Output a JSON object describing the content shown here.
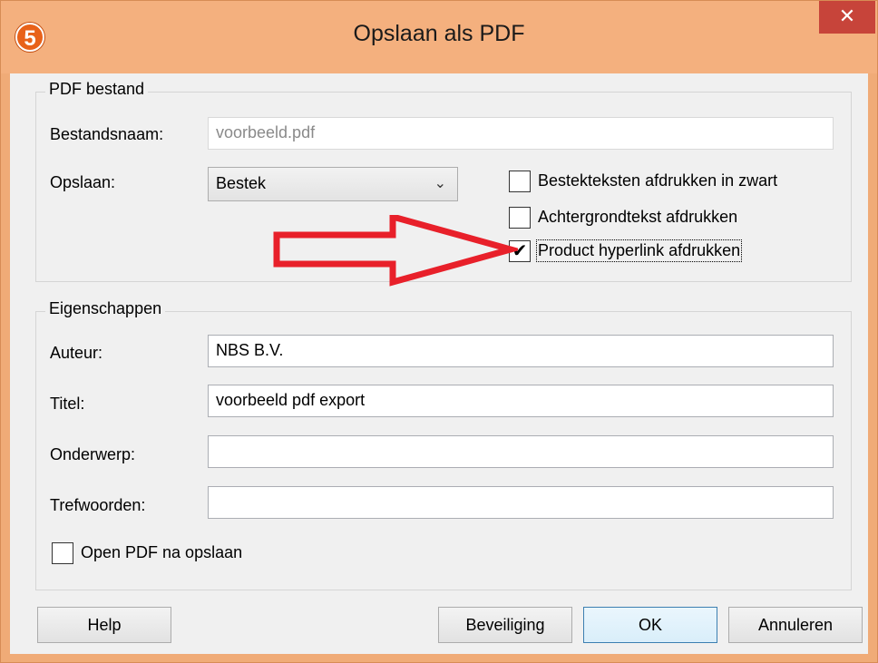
{
  "window": {
    "title": "Opslaan als PDF",
    "app_icon_glyph": "5",
    "close_glyph": "✕"
  },
  "pdf_group": {
    "legend": "PDF bestand",
    "filename_label": "Bestandsnaam:",
    "filename_value": "voorbeeld.pdf",
    "save_label": "Opslaan:",
    "save_selected": "Bestek",
    "checkboxes": [
      {
        "label": "Bestekteksten afdrukken in zwart",
        "checked": false
      },
      {
        "label": "Achtergrondtekst afdrukken",
        "checked": false
      },
      {
        "label": "Product hyperlink afdrukken",
        "checked": true
      }
    ]
  },
  "props_group": {
    "legend": "Eigenschappen",
    "author_label": "Auteur:",
    "author_value": "NBS B.V.",
    "title_label": "Titel:",
    "title_value": "voorbeeld pdf export",
    "subject_label": "Onderwerp:",
    "subject_value": "",
    "keywords_label": "Trefwoorden:",
    "keywords_value": "",
    "open_after_label": "Open PDF na opslaan",
    "open_after_checked": false
  },
  "buttons": {
    "help": "Help",
    "security": "Beveiliging",
    "ok": "OK",
    "cancel": "Annuleren"
  },
  "colors": {
    "titlebar": "#f4b07e",
    "close": "#c7443a",
    "annotation_arrow": "#e8202a"
  },
  "icons": {
    "app": "app-logo-icon",
    "close": "close-icon",
    "combo": "chevron-down-icon",
    "check": "checkmark-icon",
    "annotation": "red-arrow-annotation"
  }
}
